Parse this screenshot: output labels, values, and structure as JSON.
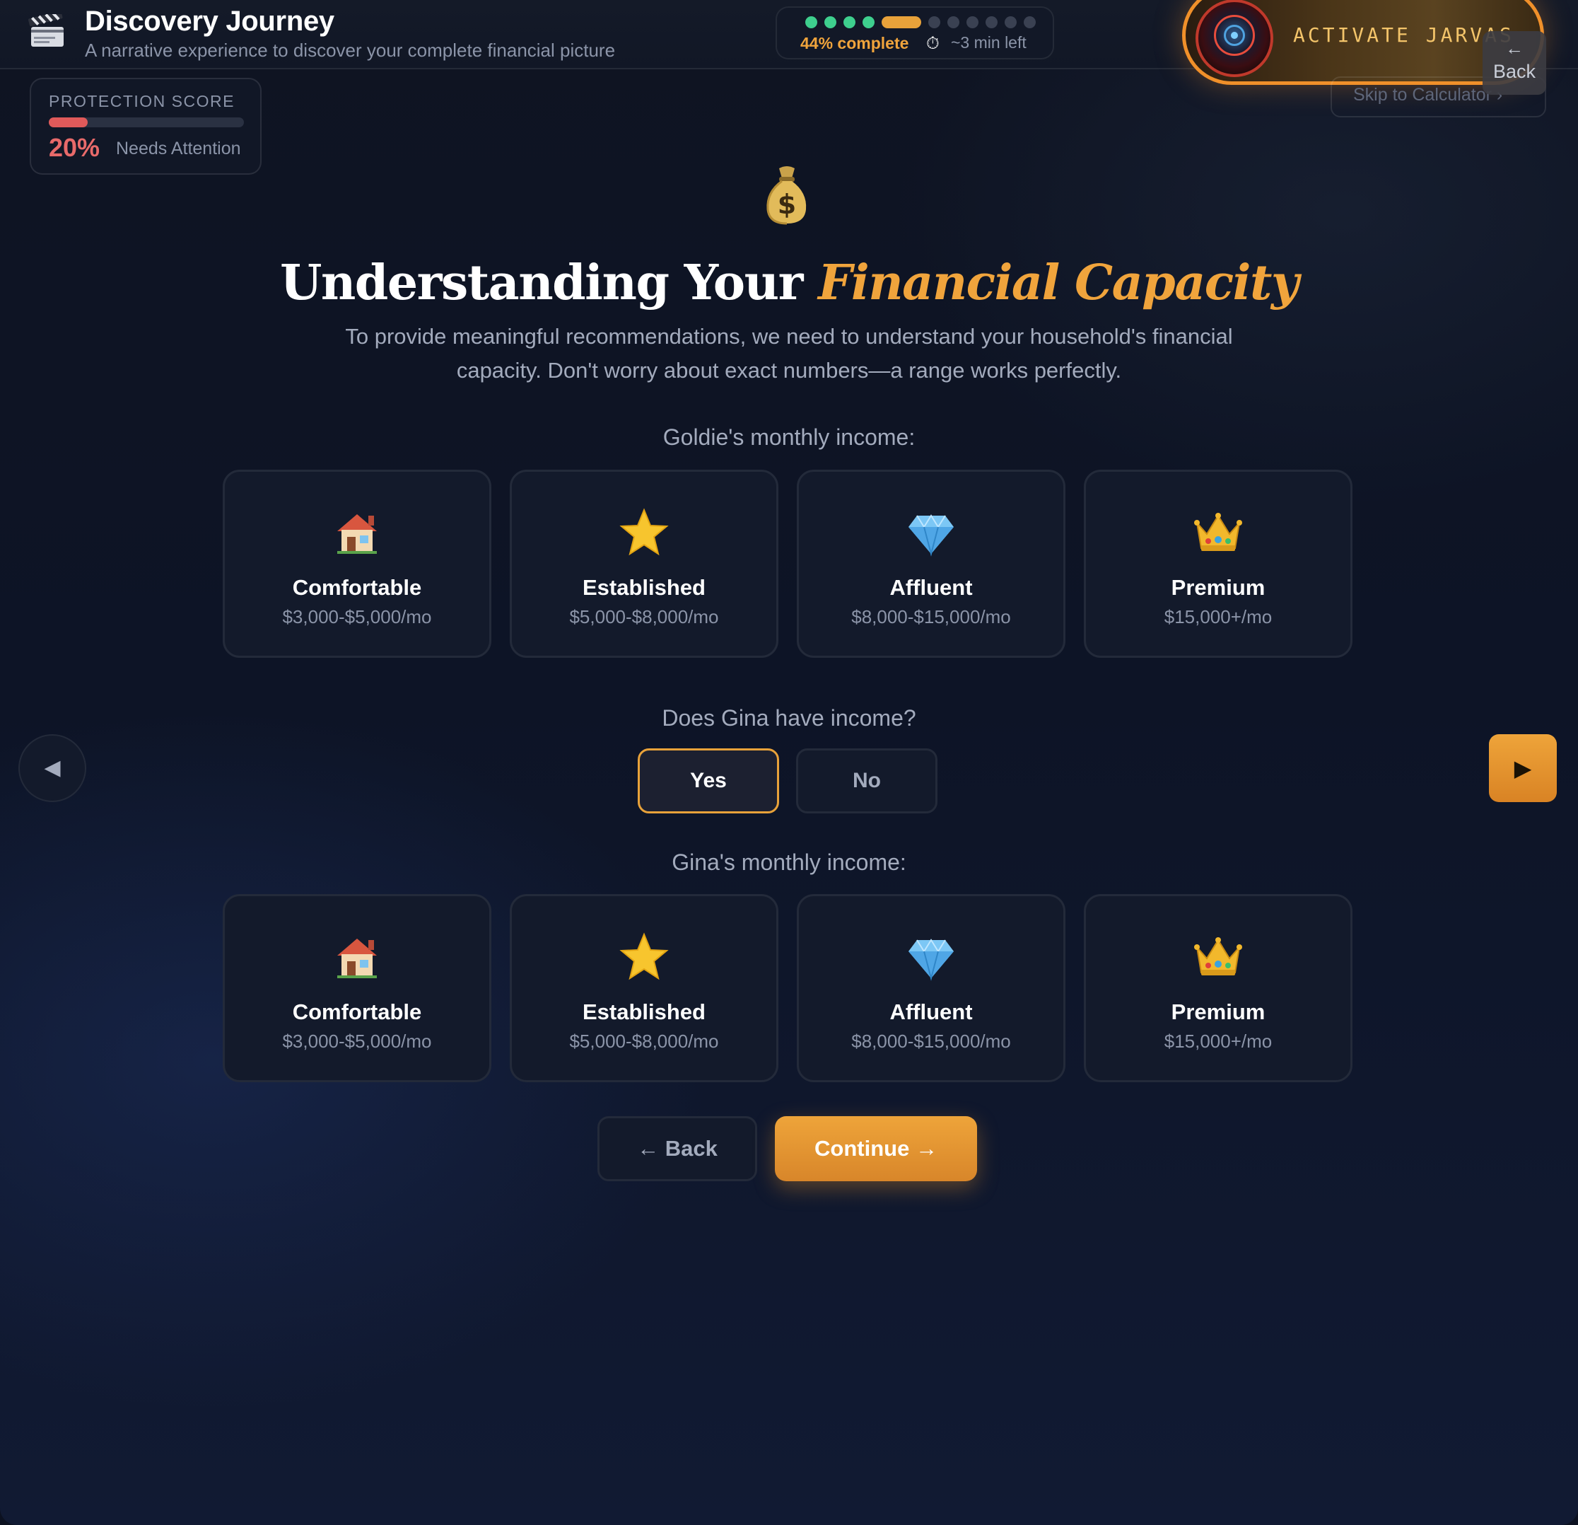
{
  "header": {
    "title": "Discovery Journey",
    "subtitle": "A narrative experience to discover your complete financial picture",
    "progress": {
      "steps_total": 11,
      "steps_done": 4,
      "current_step": 5,
      "percent_label": "44% complete",
      "time_left": "~3 min left"
    }
  },
  "jarvis": {
    "label": "ACTIVATE JARVAS"
  },
  "skip_link": "Skip to Calculator",
  "back_top": "Back",
  "protection_score": {
    "label": "PROTECTION SCORE",
    "value_label": "20%",
    "fill_fraction": 0.2,
    "status": "Needs Attention"
  },
  "hero": {
    "icon": "money-bag-icon",
    "title_plain": "Understanding Your",
    "title_accent": "Financial Capacity",
    "description": "To provide meaningful recommendations, we need to understand your household's financial capacity. Don't worry about exact numbers—a range works perfectly."
  },
  "goldie": {
    "question": "Goldie's monthly income:",
    "options": [
      {
        "icon": "house-icon",
        "title": "Comfortable",
        "range": "$3,000-$5,000/mo"
      },
      {
        "icon": "star-icon",
        "title": "Established",
        "range": "$5,000-$8,000/mo"
      },
      {
        "icon": "diamond-icon",
        "title": "Affluent",
        "range": "$8,000-$15,000/mo"
      },
      {
        "icon": "crown-icon",
        "title": "Premium",
        "range": "$15,000+/mo"
      }
    ]
  },
  "gina_has_income": {
    "question": "Does Gina have income?",
    "yes_label": "Yes",
    "no_label": "No",
    "selected": "Yes"
  },
  "gina": {
    "question": "Gina's monthly income:",
    "options": [
      {
        "icon": "house-icon",
        "title": "Comfortable",
        "range": "$3,000-$5,000/mo"
      },
      {
        "icon": "star-icon",
        "title": "Established",
        "range": "$5,000-$8,000/mo"
      },
      {
        "icon": "diamond-icon",
        "title": "Affluent",
        "range": "$8,000-$15,000/mo"
      },
      {
        "icon": "crown-icon",
        "title": "Premium",
        "range": "$15,000+/mo"
      }
    ]
  },
  "footer": {
    "back_label": "← Back",
    "continue_label": "Continue →"
  },
  "colors": {
    "accent": "#f0a43c",
    "done": "#3ecf8e",
    "danger": "#e86a6a",
    "background": "#0c1120"
  }
}
